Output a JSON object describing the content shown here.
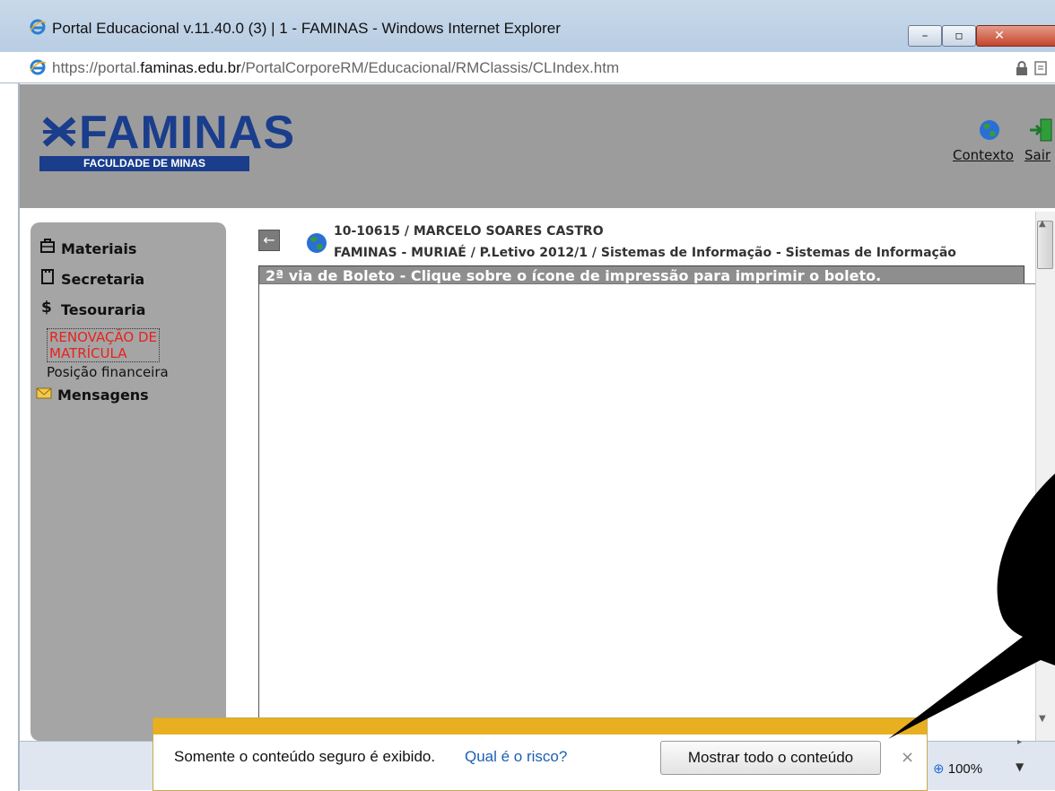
{
  "window": {
    "title": "Portal Educacional v.11.40.0 (3) | 1 - FAMINAS - Windows Internet Explorer",
    "minimize_label": "–",
    "maximize_label": "▫",
    "close_label": "✕"
  },
  "address_bar": {
    "url_prefix": "https://portal.",
    "url_domain": "faminas.edu.br",
    "url_path": "/PortalCorporeRM/Educacional/RMClassis/CLIndex.htm"
  },
  "header": {
    "logo_text": "FAMINAS",
    "logo_subtitle": "FACULDADE DE MINAS",
    "contexto_label": "Contexto",
    "sair_label": "Sair"
  },
  "sidebar": {
    "items": [
      {
        "label": "Materiais",
        "icon": "backpack-icon"
      },
      {
        "label": "Secretaria",
        "icon": "clipboard-icon"
      },
      {
        "label": "Tesouraria",
        "icon": "dollar-icon"
      },
      {
        "label": "RENOVAÇÃO DE",
        "icon": ""
      },
      {
        "label": "MATRÍCULA",
        "icon": ""
      },
      {
        "label": "Posição financeira",
        "icon": ""
      },
      {
        "label": "Mensagens",
        "icon": "envelope-icon"
      }
    ]
  },
  "content": {
    "back_label": "←",
    "student_line": "10-10615 / MARCELO SOARES CASTRO",
    "course_line": "FAMINAS - MURIAÉ / P.Letivo 2012/1  / Sistemas de Informação - Sistemas de Informação",
    "boleto_title": "2ª via de Boleto - Clique sobre o ícone de impressão para imprimir o boleto."
  },
  "notification": {
    "message": "Somente o conteúdo seguro é exibido.",
    "link": "Qual é o risco?",
    "button": "Mostrar todo o conteúdo",
    "close": "×"
  },
  "status_bar": {
    "zoom": "100%"
  },
  "colors": {
    "header_bg": "#9c9c9c",
    "sidebar_bg": "#a5a5a5",
    "logo_blue": "#1a3d8c",
    "alert_red": "#e8221c",
    "notif_bar": "#e8b020"
  }
}
